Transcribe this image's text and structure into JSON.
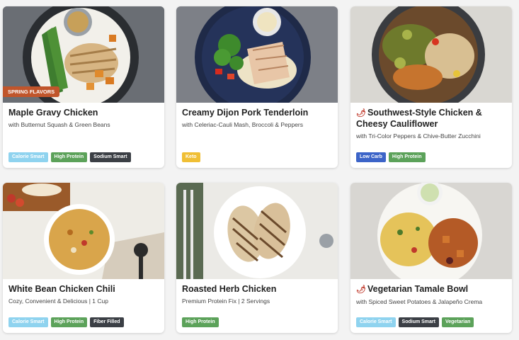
{
  "cards": [
    {
      "title": "Maple Gravy Chicken",
      "subtitle": "with Butternut Squash & Green Beans",
      "ribbon": "SPRING FLAVORS",
      "spicy": false,
      "tags": [
        {
          "label": "Calorie Smart",
          "color": "#8fd3ef"
        },
        {
          "label": "High Protein",
          "color": "#5ca25a"
        },
        {
          "label": "Sodium Smart",
          "color": "#3b3f45"
        }
      ]
    },
    {
      "title": "Creamy Dijon Pork Tenderloin",
      "subtitle": "with Celeriac-Cauli Mash, Broccoli & Peppers",
      "spicy": false,
      "tags": [
        {
          "label": "Keto",
          "color": "#f0bf35"
        }
      ]
    },
    {
      "title": "Southwest-Style Chicken & Cheesy Cauliflower",
      "subtitle": "with Tri-Color Peppers & Chive-Butter Zucchini",
      "spicy": true,
      "tags": [
        {
          "label": "Low Carb",
          "color": "#3c64c8"
        },
        {
          "label": "High Protein",
          "color": "#5ca25a"
        }
      ]
    },
    {
      "title": "White Bean Chicken Chili",
      "subtitle": "Cozy, Convenient & Delicious | 1 Cup",
      "spicy": false,
      "tags": [
        {
          "label": "Calorie Smart",
          "color": "#8fd3ef"
        },
        {
          "label": "High Protein",
          "color": "#5ca25a"
        },
        {
          "label": "Fiber Filled",
          "color": "#3b3f45"
        }
      ]
    },
    {
      "title": "Roasted Herb Chicken",
      "subtitle": "Premium Protein Fix | 2 Servings",
      "spicy": false,
      "tags": [
        {
          "label": "High Protein",
          "color": "#5ca25a"
        }
      ]
    },
    {
      "title": "Vegetarian Tamale Bowl",
      "subtitle": "with Spiced Sweet Potatoes & Jalapeño Crema",
      "spicy": true,
      "tags": [
        {
          "label": "Calorie Smart",
          "color": "#8fd3ef"
        },
        {
          "label": "Sodium Smart",
          "color": "#3b3f45"
        },
        {
          "label": "Vegetarian",
          "color": "#5ca25a"
        }
      ]
    }
  ]
}
